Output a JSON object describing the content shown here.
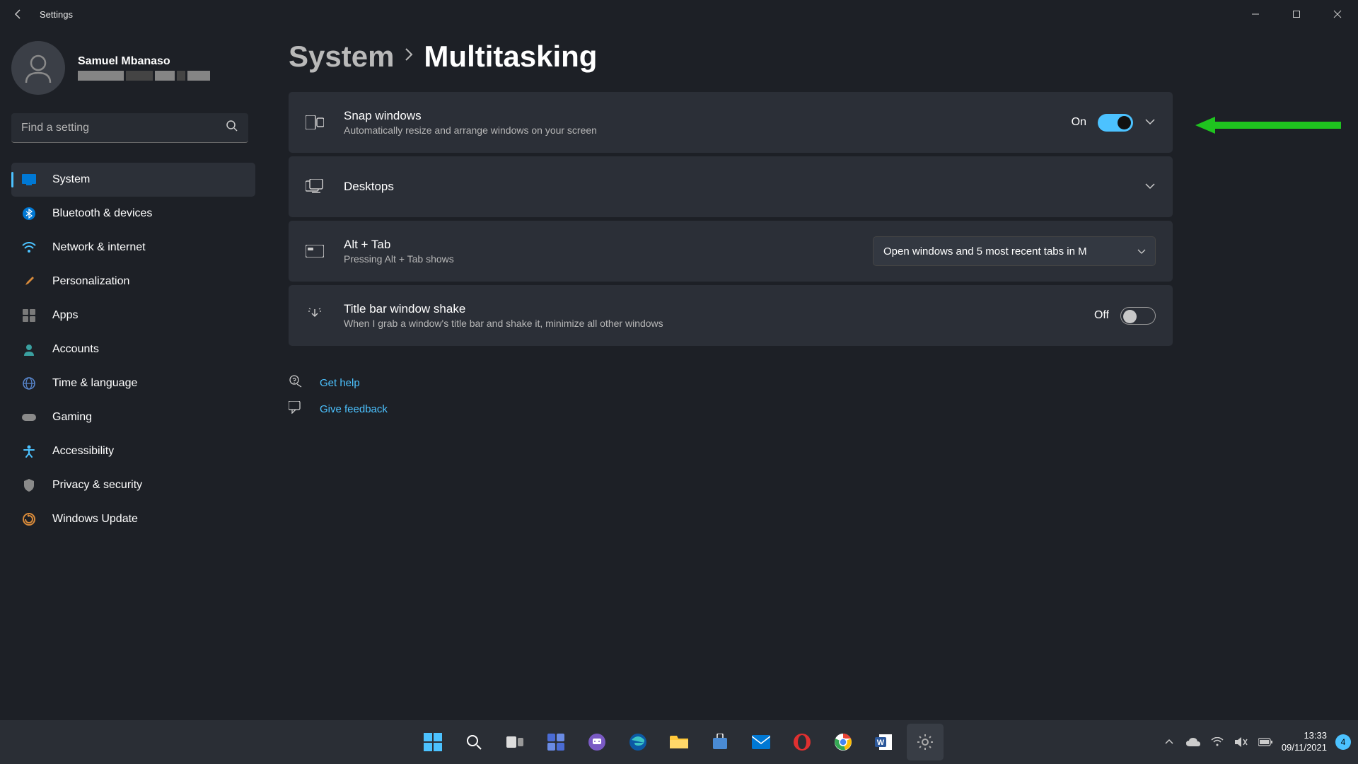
{
  "titlebar": {
    "title": "Settings"
  },
  "profile": {
    "name": "Samuel Mbanaso"
  },
  "search": {
    "placeholder": "Find a setting"
  },
  "nav": [
    {
      "label": "System",
      "icon": "system"
    },
    {
      "label": "Bluetooth & devices",
      "icon": "bluetooth"
    },
    {
      "label": "Network & internet",
      "icon": "wifi"
    },
    {
      "label": "Personalization",
      "icon": "brush"
    },
    {
      "label": "Apps",
      "icon": "apps"
    },
    {
      "label": "Accounts",
      "icon": "person"
    },
    {
      "label": "Time & language",
      "icon": "globe"
    },
    {
      "label": "Gaming",
      "icon": "game"
    },
    {
      "label": "Accessibility",
      "icon": "access"
    },
    {
      "label": "Privacy & security",
      "icon": "shield"
    },
    {
      "label": "Windows Update",
      "icon": "update"
    }
  ],
  "breadcrumb": {
    "root": "System",
    "current": "Multitasking"
  },
  "cards": {
    "snap": {
      "title": "Snap windows",
      "sub": "Automatically resize and arrange windows on your screen",
      "status": "On"
    },
    "desktops": {
      "title": "Desktops"
    },
    "alttab": {
      "title": "Alt + Tab",
      "sub": "Pressing Alt + Tab shows",
      "dropdown": "Open windows and 5 most recent tabs in M"
    },
    "shake": {
      "title": "Title bar window shake",
      "sub": "When I grab a window's title bar and shake it, minimize all other windows",
      "status": "Off"
    }
  },
  "links": {
    "help": "Get help",
    "feedback": "Give feedback"
  },
  "clock": {
    "time": "13:33",
    "date": "09/11/2021"
  },
  "notif_count": "4"
}
